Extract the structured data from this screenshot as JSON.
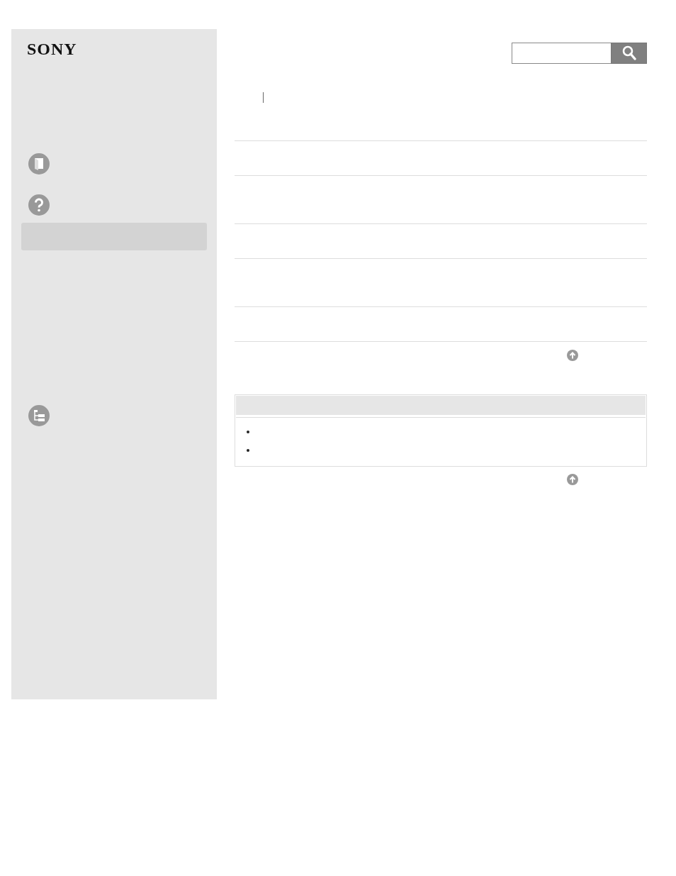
{
  "header": {
    "logo": "SONY"
  },
  "sidebar": {
    "items": [
      {
        "kind": "book",
        "selected": false
      },
      {
        "kind": "help",
        "selected": false
      },
      {
        "kind": "blank",
        "selected": true
      },
      {
        "kind": "tree",
        "selected": false
      }
    ]
  }
}
